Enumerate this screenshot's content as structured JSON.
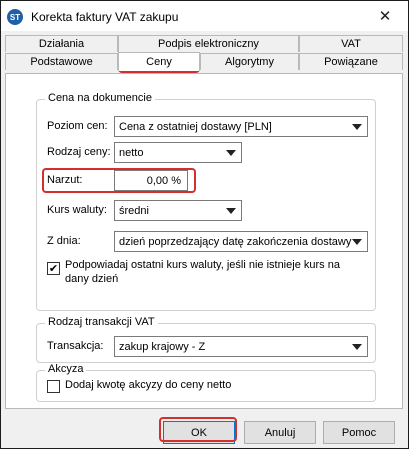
{
  "window": {
    "title": "Korekta faktury VAT zakupu",
    "icon": "app-logo-icon",
    "close_glyph": "✕"
  },
  "tabs": {
    "row1": [
      {
        "label": "Działania"
      },
      {
        "label": "Podpis elektroniczny"
      },
      {
        "label": "VAT"
      }
    ],
    "row2": [
      {
        "label": "Podstawowe"
      },
      {
        "label": "Ceny",
        "active": true
      },
      {
        "label": "Algorytmy"
      },
      {
        "label": "Powiązane"
      }
    ]
  },
  "price_group": {
    "legend": "Cena na dokumencie",
    "price_level_label": "Poziom cen:",
    "price_level_value": "Cena z ostatniej dostawy [PLN]",
    "price_type_label": "Rodzaj ceny:",
    "price_type_value": "netto",
    "markup_label": "Narzut:",
    "markup_value": "0,00 %",
    "exchange_rate_label": "Kurs waluty:",
    "exchange_rate_value": "średni",
    "date_label": "Z dnia:",
    "date_value": "dzień poprzedzający datę zakończenia dostawy",
    "suggest_rate_checked": true,
    "suggest_rate_label_line1": "Podpowiadaj ostatni kurs waluty, jeśli nie istnieje kurs na",
    "suggest_rate_label_line2": "dany dzień"
  },
  "vat_group": {
    "legend": "Rodzaj transakcji VAT",
    "transaction_label": "Transakcja:",
    "transaction_value": "zakup krajowy - Z"
  },
  "excise_group": {
    "legend": "Akcyza",
    "add_excise_checked": false,
    "add_excise_label": "Dodaj kwotę akcyzy do ceny netto"
  },
  "buttons": {
    "ok": "OK",
    "cancel": "Anuluj",
    "help": "Pomoc"
  },
  "colors": {
    "highlight": "#d32f2f",
    "accent": "#0078d7"
  }
}
